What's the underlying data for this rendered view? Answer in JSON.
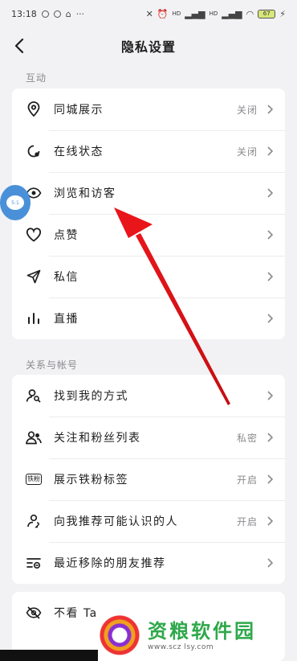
{
  "status_bar": {
    "time": "13:18",
    "more": "···",
    "net_badge_1": "HD",
    "net_badge_2": "HD",
    "battery": "67"
  },
  "header": {
    "title": "隐私设置",
    "back_icon": "chevron-left-icon"
  },
  "sections": [
    {
      "label": "互动",
      "items": [
        {
          "label": "同城展示",
          "value": "关闭",
          "icon": "location-pin-icon"
        },
        {
          "label": "在线状态",
          "value": "关闭",
          "icon": "online-status-icon"
        },
        {
          "label": "浏览和访客",
          "value": "",
          "icon": "eye-icon"
        },
        {
          "label": "点赞",
          "value": "",
          "icon": "heart-icon"
        },
        {
          "label": "私信",
          "value": "",
          "icon": "paper-plane-icon"
        },
        {
          "label": "直播",
          "value": "",
          "icon": "bar-chart-icon"
        }
      ]
    },
    {
      "label": "关系与帐号",
      "items": [
        {
          "label": "找到我的方式",
          "value": "",
          "icon": "person-search-icon"
        },
        {
          "label": "关注和粉丝列表",
          "value": "私密",
          "icon": "people-icon"
        },
        {
          "label": "展示铁粉标签",
          "value": "开启",
          "icon": "tiefen-badge-icon",
          "badge": "铁粉"
        },
        {
          "label": "向我推荐可能认识的人",
          "value": "开启",
          "icon": "recommend-people-icon"
        },
        {
          "label": "最近移除的朋友推荐",
          "value": "",
          "icon": "removed-list-icon"
        }
      ]
    },
    {
      "label": "",
      "items": [
        {
          "label": "不看 Ta",
          "value": "",
          "icon": "eye-off-icon"
        }
      ]
    }
  ],
  "overlay": {
    "float_bubble_text": "5:1",
    "watermark_title": "资粮软件园",
    "watermark_url": "www.scz lsy.com"
  },
  "colors": {
    "background": "#f2f2f4",
    "card": "#ffffff",
    "secondary_text": "#8a8a8e",
    "annotation_arrow": "#e8151b"
  }
}
